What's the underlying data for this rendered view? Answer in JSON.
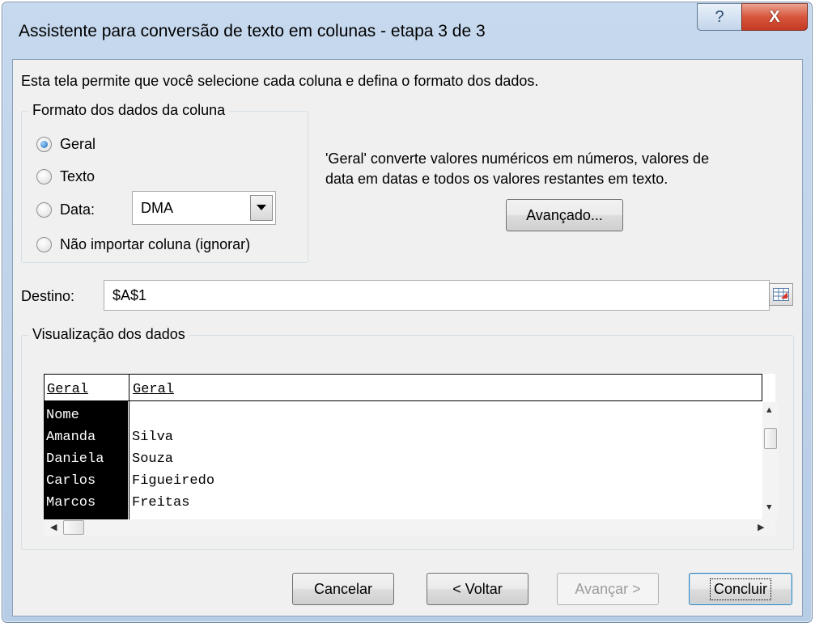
{
  "window": {
    "title": "Assistente para conversão de texto em colunas - etapa 3 de 3",
    "help_symbol": "?",
    "close_symbol": "X"
  },
  "intro_text": "Esta tela permite que você selecione cada coluna e defina o formato dos dados.",
  "column_format": {
    "group_label": "Formato dos dados da coluna",
    "options": [
      {
        "label": "Geral",
        "checked": true
      },
      {
        "label": "Texto",
        "checked": false
      },
      {
        "label": "Data:",
        "checked": false
      },
      {
        "label": "Não importar coluna (ignorar)",
        "checked": false
      }
    ],
    "date_format_value": "DMA"
  },
  "description": {
    "line1": "'Geral' converte valores numéricos em números, valores de",
    "line2": "data em datas e todos os valores restantes em texto."
  },
  "advanced_button": "Avançado...",
  "destination": {
    "label": "Destino:",
    "value": "$A$1"
  },
  "preview": {
    "group_label": "Visualização dos dados",
    "headers": [
      "Geral",
      "Geral"
    ],
    "rows": [
      [
        "Nome",
        ""
      ],
      [
        "Amanda",
        "Silva"
      ],
      [
        "Daniela",
        "Souza"
      ],
      [
        "Carlos",
        "Figueiredo"
      ],
      [
        "Marcos",
        "Freitas"
      ]
    ]
  },
  "buttons": {
    "cancel": "Cancelar",
    "back": "< Voltar",
    "next": "Avançar >",
    "finish": "Concluir"
  },
  "colors": {
    "close_button": "#c9442b",
    "title_bar": "#bfd4ec",
    "selected_column": "#000000"
  }
}
